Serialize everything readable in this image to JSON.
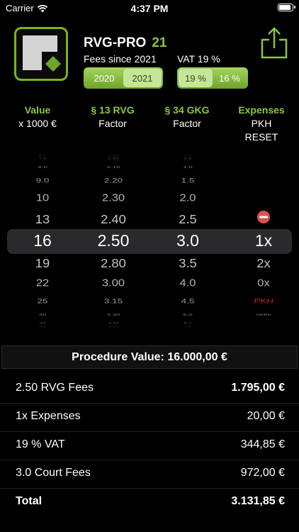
{
  "status": {
    "carrier": "Carrier",
    "time": "4:37 PM",
    "battery_level": 0.92
  },
  "app": {
    "title": "RVG-PRO",
    "version": "21",
    "fees_label": "Fees since 2021",
    "vat_label": "VAT 19 %",
    "year_options": [
      "2020",
      "2021"
    ],
    "year_selected": "2021",
    "vat_options": [
      "19 %",
      "16 %"
    ],
    "vat_selected": "19 %"
  },
  "columns": {
    "value": {
      "title": "Value",
      "subtitle": "x 1000 €"
    },
    "rvg": {
      "title": "§ 13 RVG",
      "subtitle": "Factor"
    },
    "gkg": {
      "title": "§ 34 GKG",
      "subtitle": "Factor"
    },
    "expenses": {
      "title": "Expenses",
      "line1": "PKH",
      "line2": "RESET"
    }
  },
  "picker": {
    "value": [
      "6.0",
      "7.0",
      "8.0",
      "9.0",
      "10",
      "13",
      "16",
      "19",
      "22",
      "25",
      "30",
      "35",
      "40"
    ],
    "rvg": [
      "1.90",
      "2.00",
      "2.10",
      "2.20",
      "2.30",
      "2.40",
      "2.50",
      "2.80",
      "3.00",
      "3.15",
      "3.30",
      "3.45",
      "3.60"
    ],
    "gkg": [
      "0.5",
      "0.5",
      "1.0",
      "1.5",
      "2.0",
      "2.5",
      "3.0",
      "3.5",
      "4.0",
      "4.5",
      "5.0",
      "6.0",
      "7.0"
    ],
    "expenses": [
      "",
      "",
      "",
      "",
      "",
      "",
      "1x",
      "2x",
      "0x",
      "PKH",
      "netto",
      "",
      ""
    ],
    "selected_index": 6
  },
  "procedure_value": "Procedure Value: 16.000,00 €",
  "summary": [
    {
      "label": "2.50 RVG Fees",
      "value": "1.795,00 €",
      "bold": "value"
    },
    {
      "label": "1x Expenses",
      "value": "20,00 €",
      "bold": ""
    },
    {
      "label": "19 % VAT",
      "value": "344,85 €",
      "bold": ""
    },
    {
      "label": "3.0 Court Fees",
      "value": "972,00 €",
      "bold": ""
    },
    {
      "label": "Total",
      "value": "3.131,85 €",
      "bold": "both"
    }
  ],
  "colors": {
    "accent": "#8dc63f",
    "pkh": "#c8232f",
    "remove": "#d9534f"
  }
}
